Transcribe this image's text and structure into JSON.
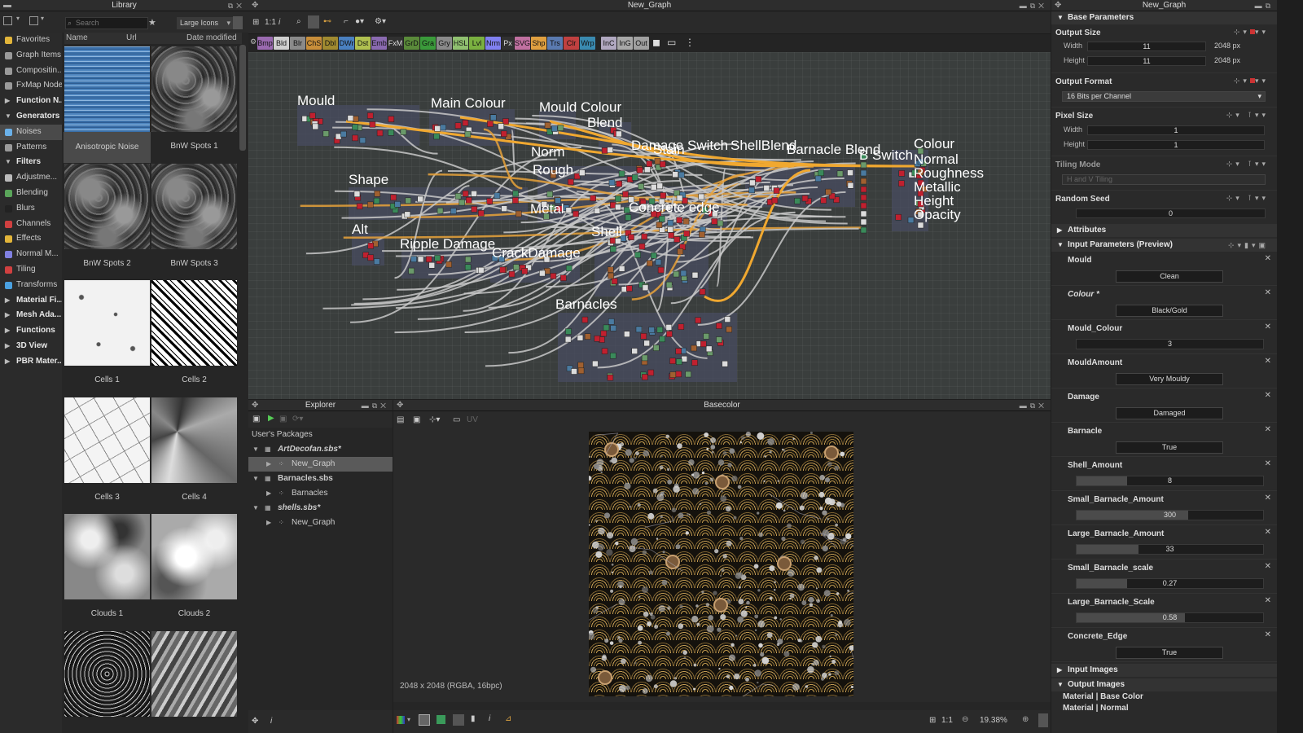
{
  "library": {
    "title": "Library",
    "search_placeholder": "Search",
    "view_mode": "Large Icons",
    "columns": [
      "Name",
      "Url",
      "Date modified"
    ],
    "categories": [
      {
        "label": "Favorites",
        "kind": "item",
        "color": "#e2b53a"
      },
      {
        "label": "Graph Items",
        "kind": "item",
        "color": "#9a9a9a"
      },
      {
        "label": "Compositin...",
        "kind": "item",
        "color": "#9a9a9a"
      },
      {
        "label": "FxMap Node",
        "kind": "item",
        "color": "#9a9a9a"
      },
      {
        "label": "Function N...",
        "kind": "header-collapsed"
      },
      {
        "label": "Generators",
        "kind": "header-open"
      },
      {
        "label": "Noises",
        "kind": "item-selected",
        "color": "#6ab0e8"
      },
      {
        "label": "Patterns",
        "kind": "item",
        "color": "#9a9a9a"
      },
      {
        "label": "Filters",
        "kind": "header-open"
      },
      {
        "label": "Adjustme...",
        "kind": "item",
        "color": "#bbbbbb"
      },
      {
        "label": "Blending",
        "kind": "item",
        "color": "#5aa55a"
      },
      {
        "label": "Blurs",
        "kind": "item",
        "color": "#222222"
      },
      {
        "label": "Channels",
        "kind": "item",
        "color": "#d04040"
      },
      {
        "label": "Effects",
        "kind": "item",
        "color": "#e2b53a"
      },
      {
        "label": "Normal M...",
        "kind": "item",
        "color": "#8080e0"
      },
      {
        "label": "Tiling",
        "kind": "item",
        "color": "#d04040"
      },
      {
        "label": "Transforms",
        "kind": "item",
        "color": "#4aa0e0"
      },
      {
        "label": "Material Fi...",
        "kind": "header-collapsed"
      },
      {
        "label": "Mesh Ada...",
        "kind": "header-collapsed"
      },
      {
        "label": "Functions",
        "kind": "header-collapsed"
      },
      {
        "label": "3D View",
        "kind": "header-collapsed"
      },
      {
        "label": "PBR Mater...",
        "kind": "header-collapsed"
      }
    ],
    "thumbnails": [
      {
        "label": "Anisotropic Noise",
        "style": "aniso",
        "selected": true
      },
      {
        "label": "BnW Spots 1",
        "style": "spots"
      },
      {
        "label": "BnW Spots 2",
        "style": "spots"
      },
      {
        "label": "BnW Spots 3",
        "style": "spots"
      },
      {
        "label": "Cells 1",
        "style": "cells1"
      },
      {
        "label": "Cells 2",
        "style": "cells2"
      },
      {
        "label": "Cells 3",
        "style": "cells3"
      },
      {
        "label": "Cells 4",
        "style": "cells4"
      },
      {
        "label": "Clouds 1",
        "style": "clouds1"
      },
      {
        "label": "Clouds 2",
        "style": "clouds2"
      },
      {
        "label": "",
        "style": "crystal"
      },
      {
        "label": "",
        "style": "waves"
      }
    ]
  },
  "graph": {
    "title": "New_Graph",
    "zoom_label": "1:1",
    "node_buttons": [
      {
        "label": "Bmp",
        "color": "#9a6ab0"
      },
      {
        "label": "Bld",
        "color": "#cfcfcf"
      },
      {
        "label": "Blr",
        "color": "#8a8a8a"
      },
      {
        "label": "ChS",
        "color": "#c88e3a"
      },
      {
        "label": "Dbl",
        "color": "#a08a30"
      },
      {
        "label": "DWr",
        "color": "#4a80c0"
      },
      {
        "label": "Dst",
        "color": "#b0c050"
      },
      {
        "label": "Emb",
        "color": "#8a6ab0"
      },
      {
        "label": "FxM",
        "color": "#303030"
      },
      {
        "label": "GrD",
        "color": "#5a8a3a"
      },
      {
        "label": "Gra",
        "color": "#3a9a3a"
      },
      {
        "label": "Gry",
        "color": "#8a8a8a"
      },
      {
        "label": "HSL",
        "color": "#90c070"
      },
      {
        "label": "Lvl",
        "color": "#7ab040"
      },
      {
        "label": "Nrm",
        "color": "#8080f0"
      },
      {
        "label": "Px",
        "color": "#303030"
      },
      {
        "label": "SVG",
        "color": "#c070a0"
      },
      {
        "label": "Shp",
        "color": "#e0a040"
      },
      {
        "label": "Trs",
        "color": "#5a7ab0"
      },
      {
        "label": "Clr",
        "color": "#c04040"
      },
      {
        "label": "Wrp",
        "color": "#3a8ab0"
      },
      {
        "label": "InC",
        "color": "#b0a8c0"
      },
      {
        "label": "InG",
        "color": "#a8a8a8"
      },
      {
        "label": "Out",
        "color": "#a0a0a0"
      }
    ],
    "frames": [
      "Mould",
      "Main Colour",
      "Mould Colour",
      "Blend",
      "Norm",
      "Rough",
      "Damage Switch",
      "Stain",
      "ShellBlend",
      "Barnacle Blend",
      "B Switch",
      "Colour",
      "Normal",
      "Roughness",
      "Metallic",
      "Height",
      "Opacity",
      "Shape",
      "Metal",
      "Concrete edge",
      "Alt",
      "Ripple Damage",
      "CrackDamage",
      "Shell",
      "Barnacles"
    ]
  },
  "explorer": {
    "title": "Explorer",
    "section": "User's Packages",
    "tree": [
      {
        "label": "ArtDecofan.sbs*",
        "level": 0,
        "italic": true
      },
      {
        "label": "New_Graph",
        "level": 1,
        "selected": true
      },
      {
        "label": "Barnacles.sbs",
        "level": 0
      },
      {
        "label": "Barnacles",
        "level": 1
      },
      {
        "label": "shells.sbs*",
        "level": 0,
        "italic": true
      },
      {
        "label": "New_Graph",
        "level": 1
      }
    ]
  },
  "view2d": {
    "title": "Basecolor",
    "channel_label": "UV",
    "info": "2048 x 2048 (RGBA, 16bpc)",
    "zoom_ratio": "1:1",
    "zoom_percent": "19.38%"
  },
  "properties": {
    "title": "New_Graph",
    "base_parameters": "Base Parameters",
    "output_size": {
      "label": "Output Size",
      "width_label": "Width",
      "height_label": "Height",
      "width": "11",
      "height": "11",
      "width_px": "2048 px",
      "height_px": "2048 px"
    },
    "output_format": {
      "label": "Output Format",
      "value": "16 Bits per Channel"
    },
    "pixel_size": {
      "label": "Pixel Size",
      "width_label": "Width",
      "height_label": "Height",
      "width": "1",
      "height": "1"
    },
    "tiling_mode": {
      "label": "Tiling Mode",
      "value": "H and V Tiling"
    },
    "random_seed": {
      "label": "Random Seed",
      "value": "0"
    },
    "attributes": "Attributes",
    "input_parameters": "Input Parameters (Preview)",
    "inputs": [
      {
        "name": "Mould",
        "type": "button",
        "value": "Clean"
      },
      {
        "name": "Colour *",
        "type": "button",
        "value": "Black/Gold",
        "italic": true
      },
      {
        "name": "Mould_Colour",
        "type": "slider",
        "value": "3",
        "fill": 0.0
      },
      {
        "name": "MouldAmount",
        "type": "button",
        "value": "Very Mouldy"
      },
      {
        "name": "Damage",
        "type": "button",
        "value": "Damaged"
      },
      {
        "name": "Barnacle",
        "type": "button",
        "value": "True"
      },
      {
        "name": "Shell_Amount",
        "type": "slider",
        "value": "8",
        "fill": 0.27
      },
      {
        "name": "Small_Barnacle_Amount",
        "type": "slider",
        "value": "300",
        "fill": 0.6
      },
      {
        "name": "Large_Barnacle_Amount",
        "type": "slider",
        "value": "33",
        "fill": 0.33
      },
      {
        "name": "Small_Barnacle_scale",
        "type": "slider",
        "value": "0.27",
        "fill": 0.27
      },
      {
        "name": "Large_Barnacle_Scale",
        "type": "slider",
        "value": "0.58",
        "fill": 0.58
      },
      {
        "name": "Concrete_Edge",
        "type": "button",
        "value": "True"
      }
    ],
    "input_images": "Input Images",
    "output_images": "Output Images",
    "outputs": [
      "Material | Base Color",
      "Material | Normal"
    ]
  }
}
